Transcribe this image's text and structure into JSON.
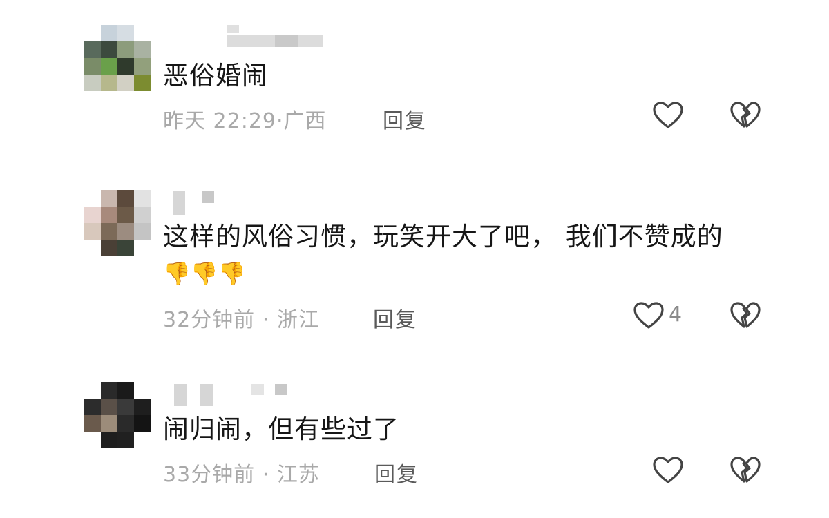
{
  "comments": [
    {
      "text": "恶俗婚闹",
      "time": "昨天 22:29",
      "location": "广西",
      "reply_label": "回复",
      "like_count": ""
    },
    {
      "text": "这样的风俗习惯，玩笑开大了吧， 我们不赞成的",
      "emoji": "👎👎👎",
      "time": "32分钟前",
      "location": "浙江",
      "reply_label": "回复",
      "like_count": "4"
    },
    {
      "text": "闹归闹，但有些过了",
      "time": "33分钟前",
      "location": "江苏",
      "reply_label": "回复",
      "like_count": ""
    }
  ],
  "meta_separator": "·",
  "icons": {
    "like": "heart-icon",
    "dislike": "broken-heart-icon"
  },
  "colors": {
    "text": "#161616",
    "meta": "#a9a9a9",
    "reply": "#5a5a5a",
    "icon": "#444444"
  }
}
